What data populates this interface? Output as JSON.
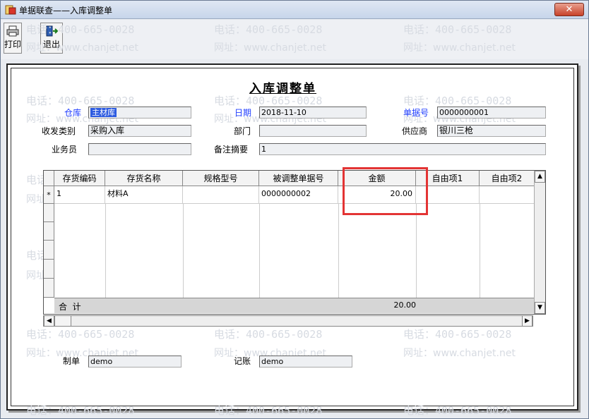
{
  "window": {
    "title": "单据联查——入库调整单",
    "close_label": "✕"
  },
  "toolbar": {
    "print_label": "打印",
    "exit_label": "退出"
  },
  "watermark": {
    "phone": "电话：400-665-0028",
    "site": "网址：www.chanjet.net"
  },
  "document": {
    "title": "入库调整单",
    "fields": {
      "warehouse_label": "仓库",
      "warehouse_value": "主材库",
      "date_label": "日期",
      "date_value": "2018-11-10",
      "doc_no_label": "单据号",
      "doc_no_value": "0000000001",
      "category_label": "收发类别",
      "category_value": "采购入库",
      "dept_label": "部门",
      "dept_value": "",
      "supplier_label": "供应商",
      "supplier_value": "银川三枪",
      "clerk_label": "业务员",
      "clerk_value": "",
      "remark_label": "备注摘要",
      "remark_value": "1"
    },
    "grid": {
      "columns": [
        "存货编码",
        "存货名称",
        "规格型号",
        "被调整单据号",
        "金额",
        "自由项1",
        "自由项2"
      ],
      "rows": [
        {
          "marker": "*",
          "code": "1",
          "name": "材料A",
          "spec": "",
          "ref_no": "0000000002",
          "amount": "20.00",
          "free1": "",
          "free2": ""
        }
      ],
      "total_label": "合  计",
      "total_amount": "20.00"
    },
    "footer": {
      "maker_label": "制单",
      "maker_value": "demo",
      "bookkeeper_label": "记账",
      "bookkeeper_value": "demo"
    }
  },
  "colors": {
    "highlight": "#e33434",
    "label_blue": "#1e3cff",
    "selection": "#2d5be0"
  }
}
